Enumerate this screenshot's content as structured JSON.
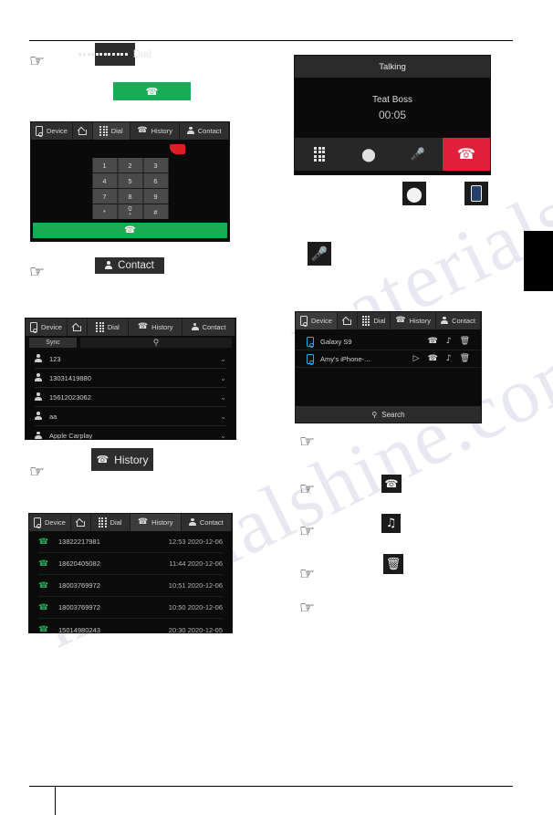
{
  "page": {
    "background": "#ffffff",
    "accent_green": "#1aab55",
    "accent_red": "#e0203a",
    "dark_panel": "#0b0b0b",
    "nav_bar": "#2f2f2f"
  },
  "nav": {
    "device": "Device",
    "home": "",
    "dial": "Dial",
    "history": "History",
    "contact": "Contact"
  },
  "inline_buttons": {
    "dial": "Dial",
    "contact": "Contact",
    "history": "History"
  },
  "dial_screen": {
    "keys": [
      {
        "main": "1",
        "sub": ""
      },
      {
        "main": "2",
        "sub": ""
      },
      {
        "main": "3",
        "sub": ""
      },
      {
        "main": "4",
        "sub": ""
      },
      {
        "main": "5",
        "sub": ""
      },
      {
        "main": "6",
        "sub": ""
      },
      {
        "main": "7",
        "sub": ""
      },
      {
        "main": "8",
        "sub": ""
      },
      {
        "main": "9",
        "sub": ""
      },
      {
        "main": "*",
        "sub": ""
      },
      {
        "main": "0",
        "sub": "+"
      },
      {
        "main": "#",
        "sub": ""
      }
    ]
  },
  "contact_screen": {
    "sync_label": "Sync",
    "search_placeholder": "",
    "contacts": [
      {
        "name": "123"
      },
      {
        "name": "13031419880"
      },
      {
        "name": "15612023062"
      },
      {
        "name": "aa"
      },
      {
        "name": "Apple Carplay"
      }
    ]
  },
  "history_screen": {
    "entries": [
      {
        "number": "13822217981",
        "time": "12:53 2020-12-06"
      },
      {
        "number": "18620405082",
        "time": "11:44 2020-12-06"
      },
      {
        "number": "18003769972",
        "time": "10:51 2020-12-06"
      },
      {
        "number": "18003769972",
        "time": "10:50 2020-12-06"
      },
      {
        "number": "15014980243",
        "time": "20:30 2020-12-05"
      }
    ]
  },
  "talking_screen": {
    "title": "Talking",
    "caller": "Teat Boss",
    "duration": "00:05",
    "buttons": {
      "keypad": "dialpad-icon",
      "bluetooth": "bluetooth-icon",
      "mute": "mute-microphone-icon",
      "hangup": "hangup-icon"
    }
  },
  "device_screen": {
    "devices": [
      {
        "name": "Galaxy S9",
        "has_play": false
      },
      {
        "name": "Amy's iPhone-...",
        "has_play": true
      }
    ],
    "search_label": "Search"
  },
  "standalone_icons": {
    "bluetooth": "bluetooth-icon",
    "phone_device": "phone-device-icon",
    "mute": "mute-microphone-icon",
    "call": "call-handset-icon",
    "music": "music-note-icon",
    "delete": "trash-can-icon"
  },
  "watermark": {
    "line1": "materialshine.com",
    "line2": "materialshine.com"
  }
}
